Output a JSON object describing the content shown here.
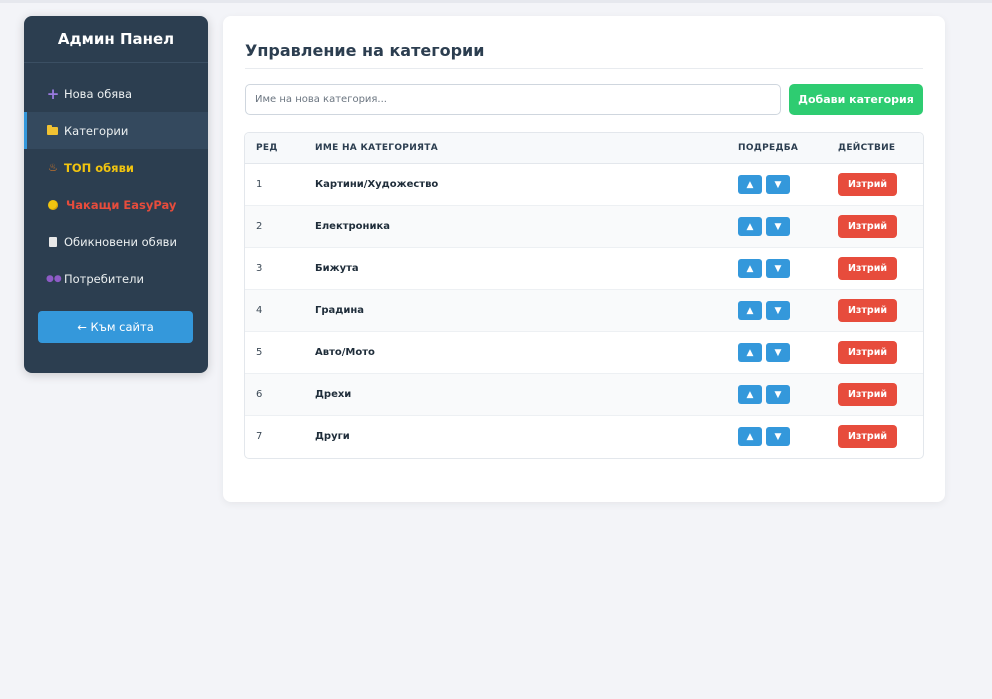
{
  "sidebar": {
    "title": "Админ Панел",
    "items": [
      {
        "icon": "plus-icon",
        "label": "Нова обява"
      },
      {
        "icon": "folder-icon",
        "label": "Категории"
      },
      {
        "icon": "fire-icon",
        "label": "ТОП обяви"
      },
      {
        "icon": "coin-icon",
        "label": "Чакащи EasyPay"
      },
      {
        "icon": "document-icon",
        "label": "Обикновени обяви"
      },
      {
        "icon": "users-icon",
        "label": "Потребители"
      }
    ],
    "back_label": "← Към сайта"
  },
  "main": {
    "title": "Управление на категории",
    "new_category_placeholder": "Име на нова категория...",
    "add_label": "Добави категория",
    "table": {
      "headers": [
        "РЕД",
        "ИМЕ НА КАТЕГОРИЯТА",
        "ПОДРЕДБА",
        "ДЕЙСТВИЕ"
      ],
      "rows": [
        {
          "order": "1",
          "name": "Картини/Художество"
        },
        {
          "order": "2",
          "name": "Електроника"
        },
        {
          "order": "3",
          "name": "Бижута"
        },
        {
          "order": "4",
          "name": "Градина"
        },
        {
          "order": "5",
          "name": "Авто/Мото"
        },
        {
          "order": "6",
          "name": "Дрехи"
        },
        {
          "order": "7",
          "name": "Други"
        }
      ],
      "up_label": "▲",
      "down_label": "▼",
      "delete_label": "Изтрий"
    }
  },
  "colors": {
    "sidebar_bg": "#2c3e50",
    "accent_blue": "#3498db",
    "success_green": "#2ecc71",
    "danger_red": "#e74c3c",
    "top_yellow": "#f1c40f"
  }
}
